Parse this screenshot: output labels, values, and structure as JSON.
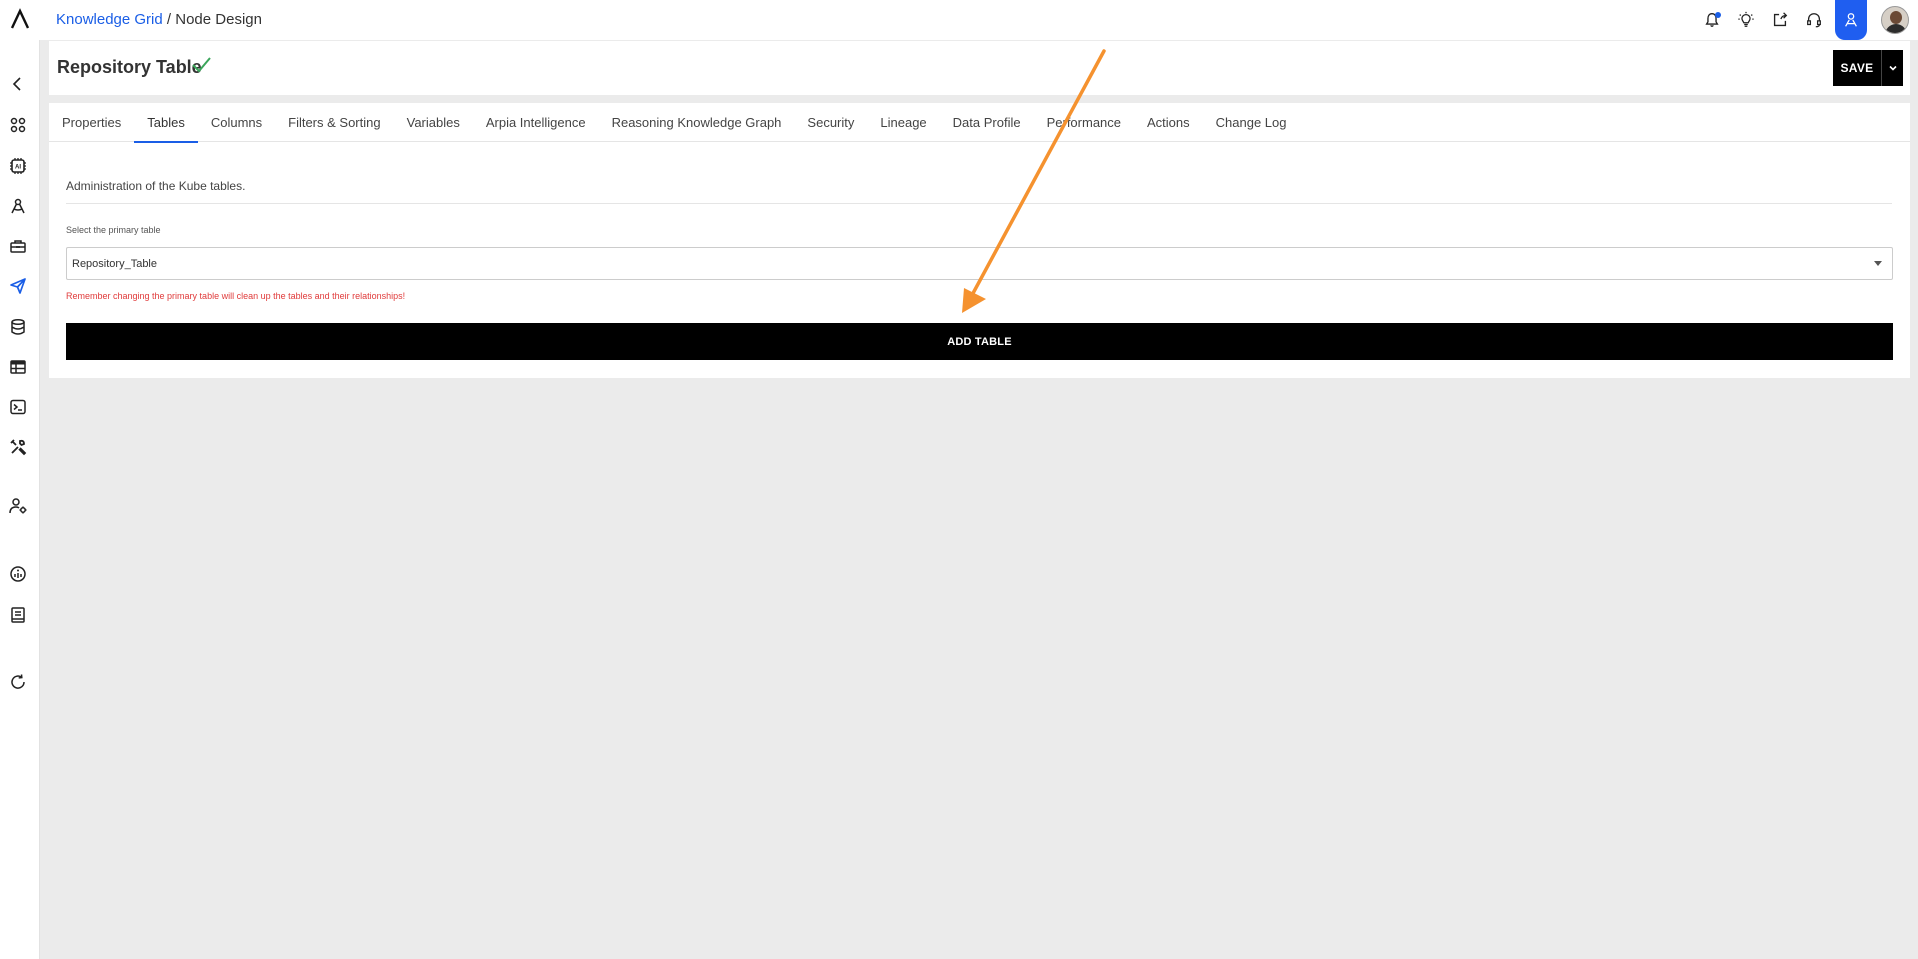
{
  "breadcrumb": {
    "link": "Knowledge Grid",
    "separator": " / ",
    "current": "Node Design"
  },
  "topbar": {
    "icons": [
      "bell-icon",
      "lightbulb-icon",
      "share-icon",
      "support-headset-icon",
      "user-design-icon",
      "user-avatar"
    ]
  },
  "sidebar": {
    "icons": [
      "back-chevron-icon",
      "apps-grid-icon",
      "ai-chip-icon",
      "compass-icon",
      "toolbox-icon",
      "send-icon",
      "database-icon",
      "table-icon",
      "terminal-icon",
      "tools-icon",
      "user-settings-icon",
      "info-icon",
      "book-icon",
      "refresh-icon"
    ],
    "active": "send-icon"
  },
  "header": {
    "title": "Repository Table",
    "save_label": "SAVE",
    "status_icon": "check-icon"
  },
  "tabs": [
    {
      "label": "Properties"
    },
    {
      "label": "Tables"
    },
    {
      "label": "Columns"
    },
    {
      "label": "Filters & Sorting"
    },
    {
      "label": "Variables"
    },
    {
      "label": "Arpia Intelligence"
    },
    {
      "label": "Reasoning Knowledge Graph"
    },
    {
      "label": "Security"
    },
    {
      "label": "Lineage"
    },
    {
      "label": "Data Profile"
    },
    {
      "label": "Performance"
    },
    {
      "label": "Actions"
    },
    {
      "label": "Change Log"
    }
  ],
  "active_tab": "Tables",
  "tables_panel": {
    "description": "Administration of the Kube tables.",
    "primary_table_label": "Select the primary table",
    "primary_table_value": "Repository_Table",
    "warning": "Remember changing the primary table will clean up the tables and their relationships!",
    "add_button_label": "ADD TABLE"
  },
  "colors": {
    "accent": "#1a5ee6",
    "primary_button": "#000000",
    "warning": "#e03b3b",
    "annotation_arrow": "#f5922f",
    "success": "#3aa55a"
  }
}
